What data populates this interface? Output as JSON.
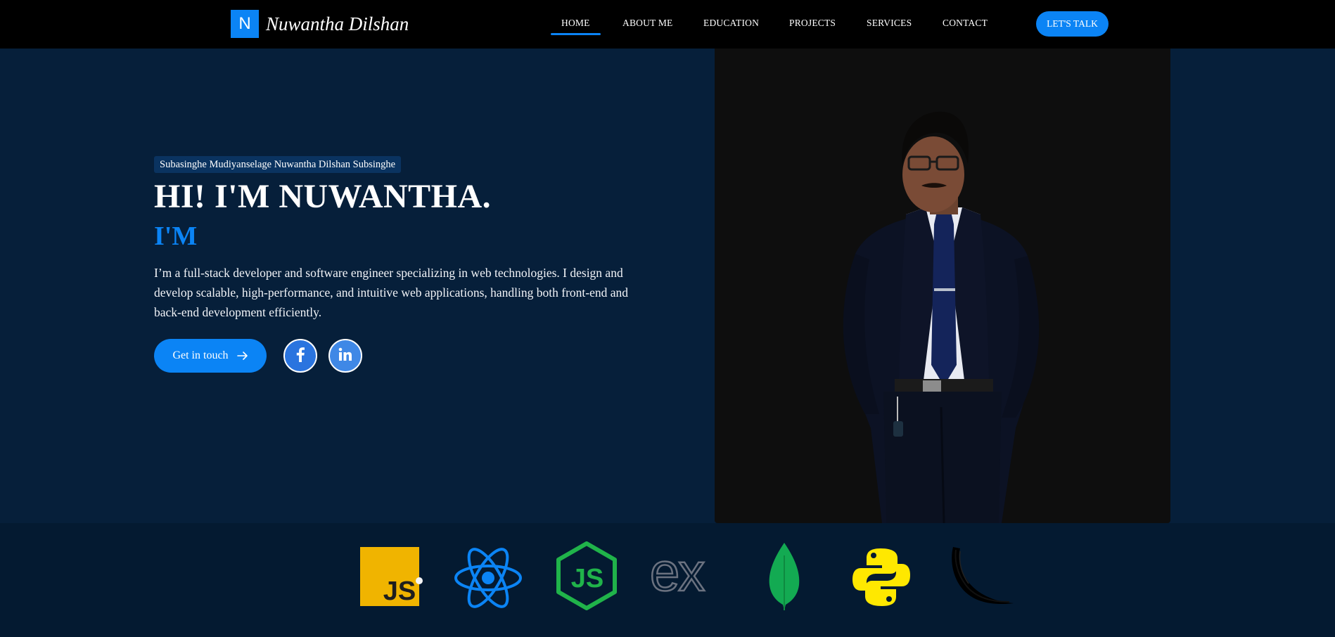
{
  "brand": {
    "initial": "N",
    "name": "Nuwantha Dilshan",
    "accent_color": "#0b84f5"
  },
  "nav": {
    "items": [
      {
        "label": "HOME",
        "active": true
      },
      {
        "label": "ABOUT ME",
        "active": false
      },
      {
        "label": "EDUCATION",
        "active": false
      },
      {
        "label": "PROJECTS",
        "active": false
      },
      {
        "label": "SERVICES",
        "active": false
      },
      {
        "label": "CONTACT",
        "active": false
      }
    ],
    "cta_label": "LET'S TALK"
  },
  "hero": {
    "full_name": "Subasinghe Mudiyanselage Nuwantha Dilshan Subsinghe",
    "title": "HI! I'M NUWANTHA.",
    "subtitle": "I'M",
    "description": "I’m a full-stack developer and software engineer specializing in web technologies. I design and develop scalable, high-performance, and intuitive web applications, handling both front-end and back-end development efficiently.",
    "cta_label": "Get in touch",
    "cta_icon": "arrow-right-icon",
    "social": [
      {
        "name": "facebook",
        "icon": "facebook-icon"
      },
      {
        "name": "linkedin",
        "icon": "linkedin-icon"
      }
    ],
    "photo": "portrait-photo"
  },
  "tech_stack": [
    {
      "name": "javascript",
      "icon": "javascript-icon",
      "color": "#f0b400"
    },
    {
      "name": "react",
      "icon": "react-icon",
      "color": "#0b84f5"
    },
    {
      "name": "nodejs",
      "icon": "nodejs-icon",
      "color": "#20b34a"
    },
    {
      "name": "express",
      "icon": "express-icon",
      "color": "#6b7280"
    },
    {
      "name": "mongodb",
      "icon": "mongodb-icon",
      "color": "#13aa52"
    },
    {
      "name": "python",
      "icon": "python-icon",
      "color": "#ffe800"
    },
    {
      "name": "flask",
      "icon": "flask-icon",
      "color": "#000000"
    }
  ]
}
